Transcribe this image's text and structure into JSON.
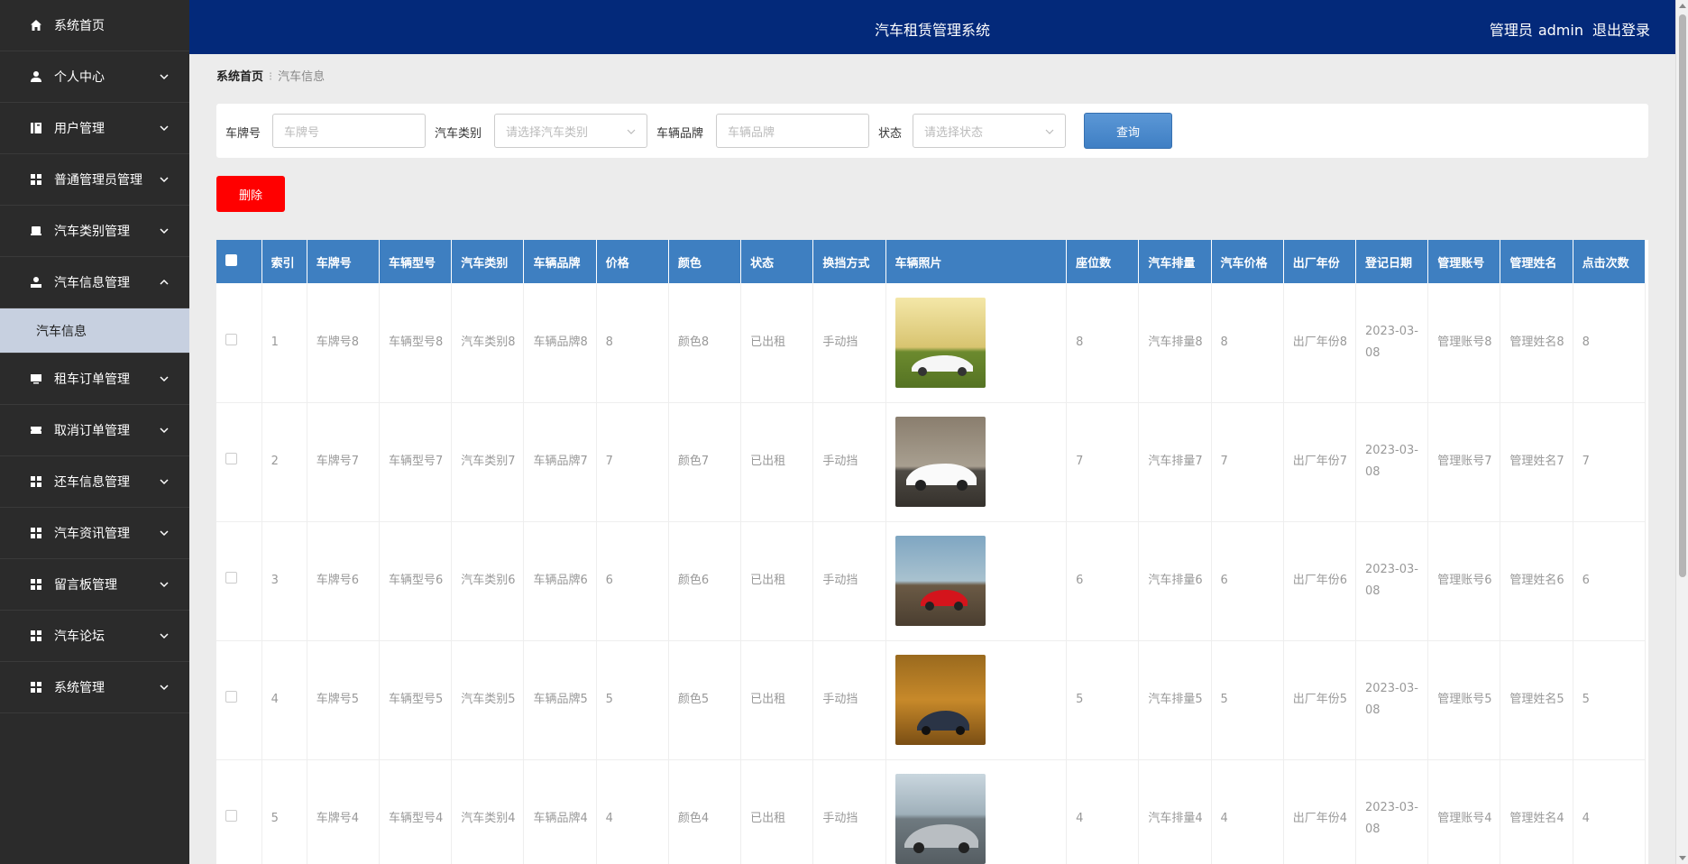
{
  "header": {
    "title": "汽车租赁管理系统",
    "role": "管理员",
    "username": "admin",
    "logout": "退出登录"
  },
  "sidebar": {
    "items": [
      {
        "label": "系统首页",
        "icon": "home-icon"
      },
      {
        "label": "个人中心",
        "icon": "user-icon"
      },
      {
        "label": "用户管理",
        "icon": "book-icon"
      },
      {
        "label": "普通管理员管理",
        "icon": "grid-icon"
      },
      {
        "label": "汽车类别管理",
        "icon": "car-icon"
      },
      {
        "label": "汽车信息管理",
        "icon": "person-icon"
      },
      {
        "label": "租车订单管理",
        "icon": "monitor-icon"
      },
      {
        "label": "取消订单管理",
        "icon": "ticket-icon"
      },
      {
        "label": "还车信息管理",
        "icon": "grid-icon"
      },
      {
        "label": "汽车资讯管理",
        "icon": "grid-icon"
      },
      {
        "label": "留言板管理",
        "icon": "grid-icon"
      },
      {
        "label": "汽车论坛",
        "icon": "grid-icon"
      },
      {
        "label": "系统管理",
        "icon": "grid-icon"
      }
    ],
    "submenu_active": "汽车信息"
  },
  "breadcrumb": {
    "home": "系统首页",
    "current": "汽车信息"
  },
  "search": {
    "plate_label": "车牌号",
    "plate_placeholder": "车牌号",
    "category_label": "汽车类别",
    "category_placeholder": "请选择汽车类别",
    "brand_label": "车辆品牌",
    "brand_placeholder": "车辆品牌",
    "status_label": "状态",
    "status_placeholder": "请选择状态",
    "query_button": "查询"
  },
  "actions": {
    "delete_button": "删除"
  },
  "table": {
    "headers": [
      "索引",
      "车牌号",
      "车辆型号",
      "汽车类别",
      "车辆品牌",
      "价格",
      "颜色",
      "状态",
      "换挡方式",
      "车辆照片",
      "座位数",
      "汽车排量",
      "汽车价格",
      "出厂年份",
      "登记日期",
      "管理账号",
      "管理姓名",
      "点击次数"
    ],
    "rows": [
      {
        "index": "1",
        "plate": "车牌号8",
        "model": "车辆型号8",
        "category": "汽车类别8",
        "brand": "车辆品牌8",
        "price": "8",
        "color": "颜色8",
        "status": "已出租",
        "gear": "手动挡",
        "seats": "8",
        "displacement": "汽车排量8",
        "car_price": "8",
        "year": "出厂年份8",
        "date": "2023-03-08",
        "account": "管理账号8",
        "admin_name": "管理姓名8",
        "clicks": "8"
      },
      {
        "index": "2",
        "plate": "车牌号7",
        "model": "车辆型号7",
        "category": "汽车类别7",
        "brand": "车辆品牌7",
        "price": "7",
        "color": "颜色7",
        "status": "已出租",
        "gear": "手动挡",
        "seats": "7",
        "displacement": "汽车排量7",
        "car_price": "7",
        "year": "出厂年份7",
        "date": "2023-03-08",
        "account": "管理账号7",
        "admin_name": "管理姓名7",
        "clicks": "7"
      },
      {
        "index": "3",
        "plate": "车牌号6",
        "model": "车辆型号6",
        "category": "汽车类别6",
        "brand": "车辆品牌6",
        "price": "6",
        "color": "颜色6",
        "status": "已出租",
        "gear": "手动挡",
        "seats": "6",
        "displacement": "汽车排量6",
        "car_price": "6",
        "year": "出厂年份6",
        "date": "2023-03-08",
        "account": "管理账号6",
        "admin_name": "管理姓名6",
        "clicks": "6"
      },
      {
        "index": "4",
        "plate": "车牌号5",
        "model": "车辆型号5",
        "category": "汽车类别5",
        "brand": "车辆品牌5",
        "price": "5",
        "color": "颜色5",
        "status": "已出租",
        "gear": "手动挡",
        "seats": "5",
        "displacement": "汽车排量5",
        "car_price": "5",
        "year": "出厂年份5",
        "date": "2023-03-08",
        "account": "管理账号5",
        "admin_name": "管理姓名5",
        "clicks": "5"
      },
      {
        "index": "5",
        "plate": "车牌号4",
        "model": "车辆型号4",
        "category": "汽车类别4",
        "brand": "车辆品牌4",
        "price": "4",
        "color": "颜色4",
        "status": "已出租",
        "gear": "手动挡",
        "seats": "4",
        "displacement": "汽车排量4",
        "car_price": "4",
        "year": "出厂年份4",
        "date": "2023-03-08",
        "account": "管理账号4",
        "admin_name": "管理姓名4",
        "clicks": "4"
      }
    ]
  },
  "colors": {
    "sidebar_bg": "#2b2b2b",
    "header_bg": "#03297a",
    "table_header_bg": "#3e7fc1",
    "delete_bg": "#ff0000",
    "active_submenu_bg": "#c7d0e0"
  }
}
